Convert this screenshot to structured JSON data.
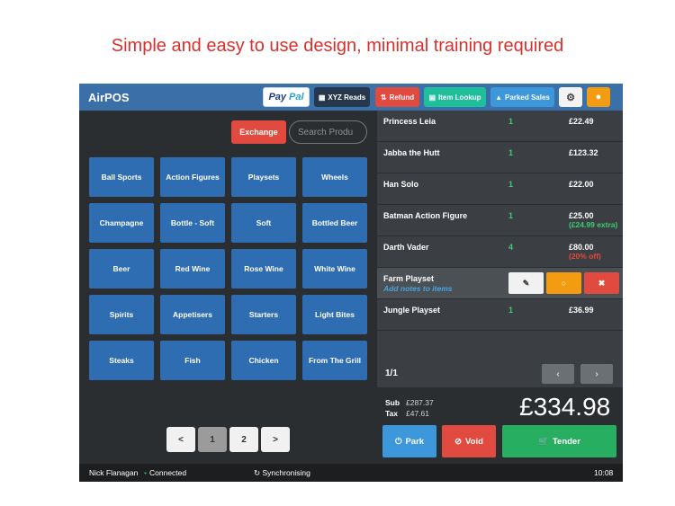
{
  "headline": "Simple and easy to use design, minimal training required",
  "app": {
    "title": "AirPOS",
    "toolbar": {
      "paypal_a": "Pay",
      "paypal_b": "Pal",
      "xyz": "XYZ Reads",
      "refund": "Refund",
      "lookup": "Item Lookup",
      "parked": "Parked Sales"
    },
    "exchange": "Exchange",
    "search_placeholder": "Search Produ",
    "categories": [
      "Ball Sports",
      "Action Figures",
      "Playsets",
      "Wheels",
      "Champagne",
      "Bottle - Soft",
      "Soft",
      "Bottled Beer",
      "Beer",
      "Red Wine",
      "Rose Wine",
      "White Wine",
      "Spirits",
      "Appetisers",
      "Starters",
      "Light Bites",
      "Steaks",
      "Fish",
      "Chicken",
      "From The Grill"
    ],
    "pager": {
      "prev": "<",
      "p1": "1",
      "p2": "2",
      "next": ">"
    }
  },
  "cart": {
    "items": [
      {
        "name": "Princess Leia",
        "qty": "1",
        "price": "£22.49"
      },
      {
        "name": "Jabba the Hutt",
        "qty": "1",
        "price": "£123.32"
      },
      {
        "name": "Han Solo",
        "qty": "1",
        "price": "£22.00"
      },
      {
        "name": "Batman Action Figure",
        "qty": "1",
        "price": "£25.00",
        "note": "(£24.99 extra)"
      },
      {
        "name": "Darth Vader",
        "qty": "4",
        "price": "£80.00",
        "note": "(20% off)"
      },
      {
        "name": "Farm Playset",
        "qty": "",
        "price": "",
        "add_notes": "Add notes to items"
      },
      {
        "name": "Jungle Playset",
        "qty": "1",
        "price": "£36.99"
      }
    ],
    "page": "1/1",
    "nav_prev": "‹",
    "nav_next": "›",
    "sub_label": "Sub",
    "sub_value": "£287.37",
    "tax_label": "Tax",
    "tax_value": "£47.61",
    "total": "£334.98",
    "park": "Park",
    "void": "Void",
    "tender": "Tender"
  },
  "status": {
    "user": "Nick Flanagan",
    "connection": "Connected",
    "sync": "Synchronising",
    "time": "10:08"
  },
  "colors": {
    "topbar": "#3a6fa8",
    "category": "#2f6db3",
    "danger": "#e04a3f",
    "success": "#27ae60",
    "warning": "#f39c12"
  }
}
